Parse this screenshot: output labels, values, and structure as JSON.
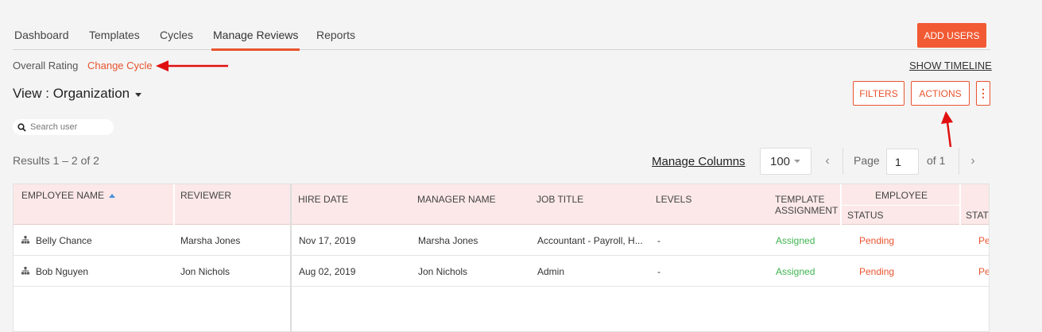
{
  "nav": {
    "tabs": [
      "Dashboard",
      "Templates",
      "Cycles",
      "Manage Reviews",
      "Reports"
    ],
    "active": "Manage Reviews",
    "add_users": "ADD USERS"
  },
  "subnav": {
    "overall_rating": "Overall Rating",
    "change_cycle": "Change Cycle",
    "show_timeline": "SHOW TIMELINE"
  },
  "view": {
    "label": "View : Organization"
  },
  "toolbar": {
    "filters": "FILTERS",
    "actions": "ACTIONS",
    "more": "⋮"
  },
  "search": {
    "placeholder": "Search user"
  },
  "pagination": {
    "results": "Results 1 – 2 of 2",
    "manage_columns": "Manage Columns",
    "per_page": "100",
    "page_label": "Page",
    "page": "1",
    "of_label": "of 1"
  },
  "table": {
    "headers": {
      "employee_name": "EMPLOYEE NAME",
      "reviewer": "REVIEWER",
      "hire_date": "HIRE DATE",
      "manager_name": "MANAGER NAME",
      "job_title": "JOB TITLE",
      "levels": "LEVELS",
      "template_assignment_1": "TEMPLATE",
      "template_assignment_2": "ASSIGNMENT",
      "employee_group": "EMPLOYEE",
      "status": "STATUS",
      "status_cut": "STAT"
    },
    "rows": [
      {
        "employee": "Belly Chance",
        "reviewer": "Marsha Jones",
        "hire_date": "Nov 17, 2019",
        "manager": "Marsha Jones",
        "job_title": "Accountant - Payroll, H...",
        "levels": "-",
        "template": "Assigned",
        "status": "Pending",
        "status_cut": "Pe"
      },
      {
        "employee": "Bob Nguyen",
        "reviewer": "Jon Nichols",
        "hire_date": "Aug 02, 2019",
        "manager": "Jon Nichols",
        "job_title": "Admin",
        "levels": "-",
        "template": "Assigned",
        "status": "Pending",
        "status_cut": "Pe"
      }
    ]
  },
  "colors": {
    "accent": "#e8542f",
    "button": "#f15a33",
    "header_bg": "#fce8e8",
    "assigned": "#3fb34f",
    "annotation": "#e01010"
  }
}
